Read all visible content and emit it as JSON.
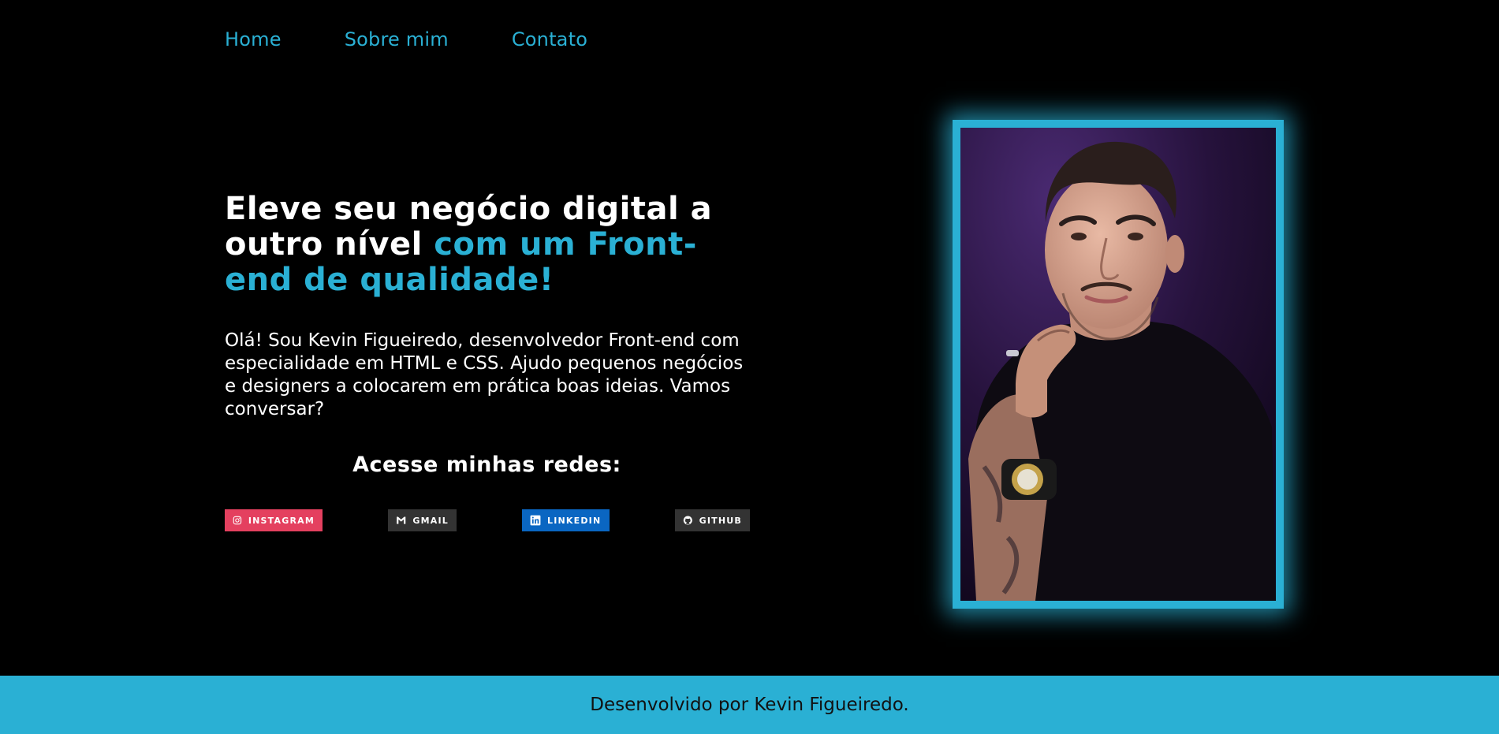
{
  "nav": {
    "items": [
      {
        "label": "Home"
      },
      {
        "label": "Sobre mim"
      },
      {
        "label": "Contato"
      }
    ]
  },
  "hero": {
    "headline_part1": "Eleve seu negócio digital a outro nível ",
    "headline_accent": "com um Front-end de qualidade!",
    "intro": "Olá! Sou Kevin Figueiredo, desenvolvedor Front-end com especialidade em HTML e CSS. Ajudo pequenos negócios e designers a colocarem em prática boas ideias. Vamos conversar?",
    "social_title": "Acesse minhas redes:"
  },
  "social": {
    "instagram": {
      "label": "INSTAGRAM",
      "icon": "instagram-icon",
      "color": "#e4405f"
    },
    "gmail": {
      "label": "GMAIL",
      "icon": "gmail-icon",
      "color": "#333333"
    },
    "linkedin": {
      "label": "LINKEDIN",
      "icon": "linkedin-icon",
      "color": "#0a66c2"
    },
    "github": {
      "label": "GITHUB",
      "icon": "github-icon",
      "color": "#333333"
    }
  },
  "photo": {
    "frame_color": "#2ab0d4"
  },
  "footer": {
    "text": "Desenvolvido por Kevin Figueiredo."
  },
  "colors": {
    "accent": "#2ab0d4",
    "background": "#000000",
    "text": "#ffffff"
  }
}
